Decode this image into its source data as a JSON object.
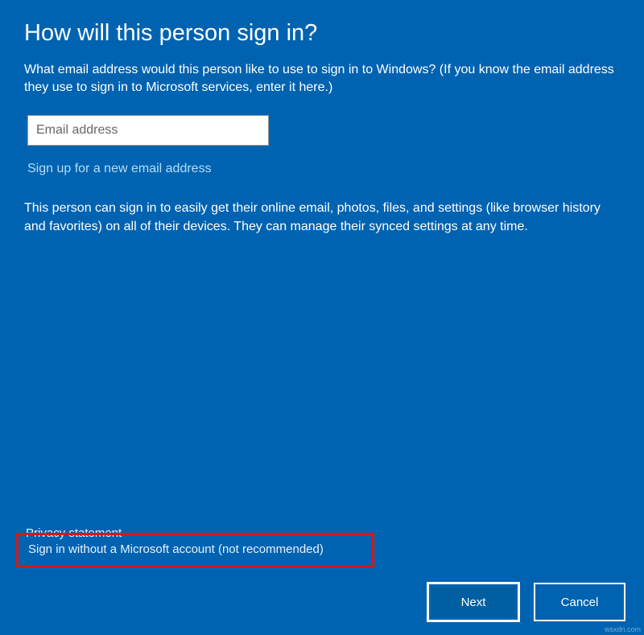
{
  "title": "How will this person sign in?",
  "description": "What email address would this person like to use to sign in to Windows? (If you know the email address they use to sign in to Microsoft services, enter it here.)",
  "email_input": {
    "placeholder": "Email address",
    "value": ""
  },
  "signup_link": "Sign up for a new email address",
  "info_text": "This person can sign in to easily get their online email, photos, files, and settings (like browser history and favorites) on all of their devices. They can manage their synced settings at any time.",
  "privacy_link": "Privacy statement",
  "no_ms_account_link": "Sign in without a Microsoft account (not recommended)",
  "buttons": {
    "next": "Next",
    "cancel": "Cancel"
  },
  "watermark": "wsxdn.com"
}
